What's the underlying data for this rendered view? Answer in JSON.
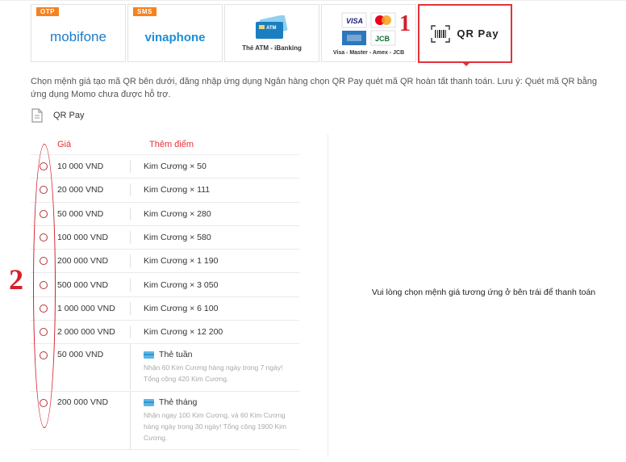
{
  "tabs": [
    {
      "badge": "OTP",
      "label": "mobifone",
      "name": "tab-mobifone"
    },
    {
      "badge": "SMS",
      "label": "vinaphone",
      "name": "tab-vinaphone"
    },
    {
      "caption": "Thẻ ATM - iBanking",
      "icon_text": "ATM",
      "name": "tab-atm"
    },
    {
      "caption": "Visa - Master - Amex - JCB",
      "visa": "VISA",
      "jcb": "JCB",
      "name": "tab-cards"
    },
    {
      "label": "QR Pay",
      "name": "tab-qrpay",
      "active": true
    }
  ],
  "annotations": {
    "marker1": "1",
    "marker2": "2"
  },
  "description": "Chọn mệnh giá tạo mã QR bên dưới, đăng nhập ứng dụng Ngân hàng chọn QR Pay quét mã QR hoàn tất thanh toán. Lưu ý: Quét mã QR bằng ứng dụng Momo chưa được hỗ trợ.",
  "section_title": "QR Pay",
  "table": {
    "headers": {
      "price": "Giá",
      "bonus": "Thêm điểm"
    },
    "rows": [
      {
        "price": "10 000 VND",
        "bonus": "Kim Cương × 50"
      },
      {
        "price": "20 000 VND",
        "bonus": "Kim Cương × 111"
      },
      {
        "price": "50 000 VND",
        "bonus": "Kim Cương × 280"
      },
      {
        "price": "100 000 VND",
        "bonus": "Kim Cương × 580"
      },
      {
        "price": "200 000 VND",
        "bonus": "Kim Cương × 1 190"
      },
      {
        "price": "500 000 VND",
        "bonus": "Kim Cương × 3 050"
      },
      {
        "price": "1 000 000 VND",
        "bonus": "Kim Cương × 6 100"
      },
      {
        "price": "2 000 000 VND",
        "bonus": "Kim Cương × 12 200"
      }
    ],
    "cards": [
      {
        "price": "50 000 VND",
        "title": "Thẻ tuần",
        "desc": "Nhận 60 Kim Cương hàng ngày trong 7 ngày! Tổng cộng 420 Kim Cương."
      },
      {
        "price": "200 000 VND",
        "title": "Thẻ tháng",
        "desc": "Nhận ngay 100 Kim Cương, và 60 Kim Cương hàng ngày trong 30 ngày! Tổng cộng 1900 Kim Cương."
      }
    ]
  },
  "right_message": "Vui lòng chọn mệnh giá tương ứng ở bên trái để thanh toán",
  "colors": {
    "accent": "#e3323a",
    "badge": "#f5821f",
    "annotation": "#d4202c"
  }
}
